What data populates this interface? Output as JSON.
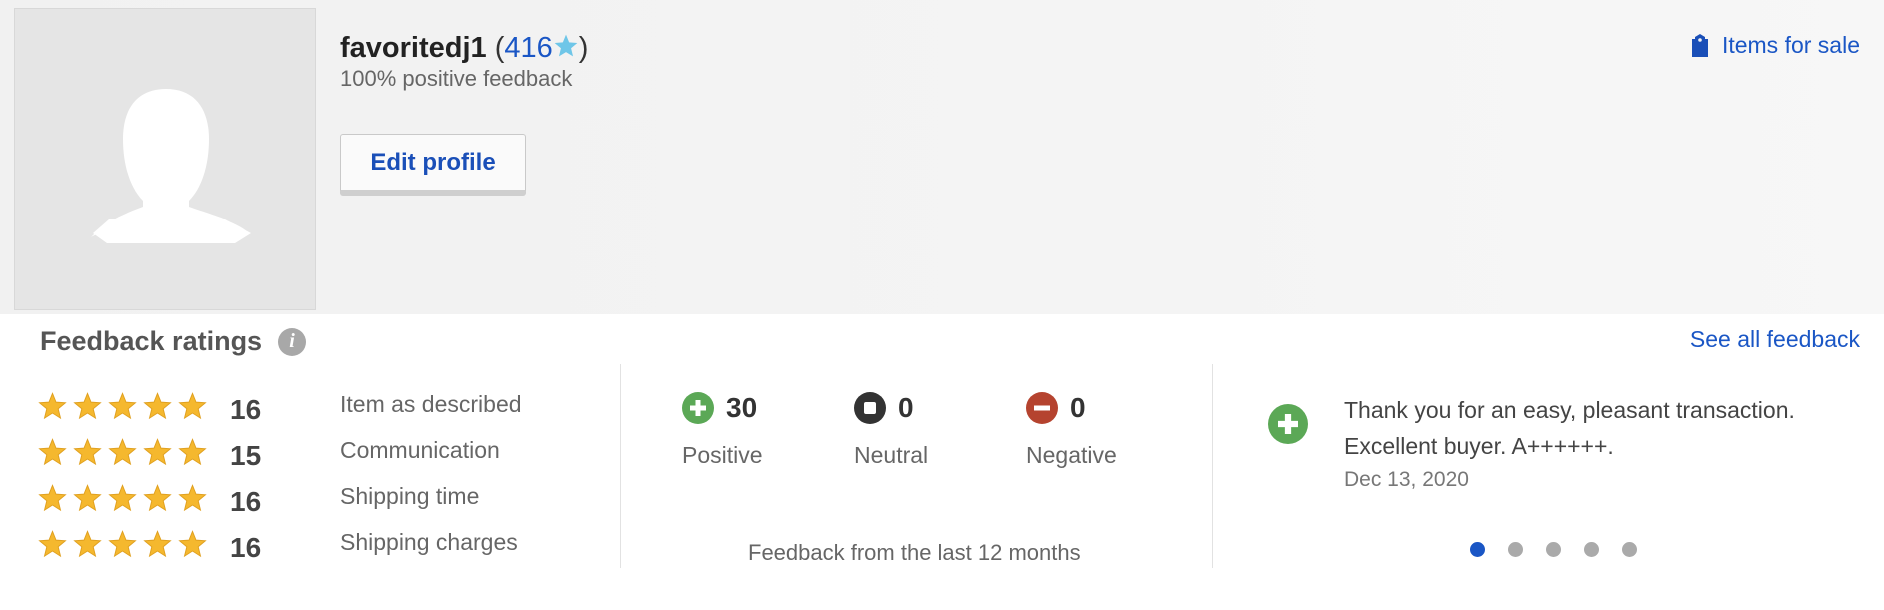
{
  "profile": {
    "username": "favoritedj1",
    "score": "416",
    "positive_feedback": "100% positive feedback",
    "edit_profile_label": "Edit profile",
    "items_for_sale_label": "Items for sale"
  },
  "feedback_ratings": {
    "title": "Feedback ratings",
    "see_all_label": "See all feedback",
    "detailed": [
      {
        "stars": 5,
        "count": "16",
        "label": "Item as described"
      },
      {
        "stars": 5,
        "count": "15",
        "label": "Communication"
      },
      {
        "stars": 5,
        "count": "16",
        "label": "Shipping time"
      },
      {
        "stars": 5,
        "count": "16",
        "label": "Shipping charges"
      }
    ],
    "summary": {
      "positive": {
        "count": "30",
        "label": "Positive"
      },
      "neutral": {
        "count": "0",
        "label": "Neutral"
      },
      "negative": {
        "count": "0",
        "label": "Negative"
      },
      "period_label": "Feedback from the last 12 months"
    },
    "recent": {
      "comment": "Thank you for an easy, pleasant transaction. Excellent buyer. A++++++.",
      "date": "Dec 13, 2020",
      "carousel_pages": 5,
      "active_page": 1
    }
  },
  "colors": {
    "link": "#1a56c5",
    "star": "#f5b82e",
    "positive": "#5ba856",
    "neutral": "#333333",
    "negative": "#b5432f"
  }
}
